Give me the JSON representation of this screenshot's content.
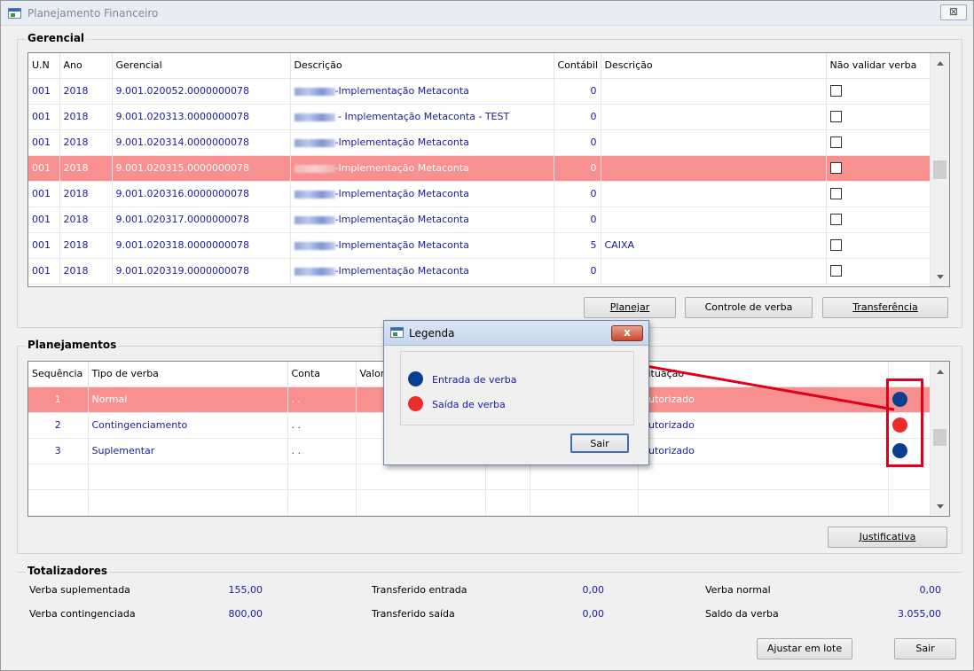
{
  "window": {
    "title": "Planejamento Financeiro",
    "close": "⊠"
  },
  "gerencial": {
    "label": "Gerencial",
    "columns": [
      "U.N",
      "Ano",
      "Gerencial",
      "Descrição",
      "Contábil",
      "Descrição",
      "Não validar verba"
    ],
    "rows": [
      {
        "un": "001",
        "ano": "2018",
        "gerencial": "9.001.020052.0000000078",
        "descricao": "-Implementação Metaconta",
        "contabil": "0",
        "descricao2": ""
      },
      {
        "un": "001",
        "ano": "2018",
        "gerencial": "9.001.020313.0000000078",
        "descricao": " - Implementação Metaconta - TEST",
        "contabil": "0",
        "descricao2": ""
      },
      {
        "un": "001",
        "ano": "2018",
        "gerencial": "9.001.020314.0000000078",
        "descricao": "-Implementação Metaconta",
        "contabil": "0",
        "descricao2": ""
      },
      {
        "un": "001",
        "ano": "2018",
        "gerencial": "9.001.020315.0000000078",
        "descricao": "-Implementação Metaconta",
        "contabil": "0",
        "descricao2": ""
      },
      {
        "un": "001",
        "ano": "2018",
        "gerencial": "9.001.020316.0000000078",
        "descricao": "-Implementação Metaconta",
        "contabil": "0",
        "descricao2": ""
      },
      {
        "un": "001",
        "ano": "2018",
        "gerencial": "9.001.020317.0000000078",
        "descricao": "-Implementação Metaconta",
        "contabil": "0",
        "descricao2": ""
      },
      {
        "un": "001",
        "ano": "2018",
        "gerencial": "9.001.020318.0000000078",
        "descricao": "-Implementação Metaconta",
        "contabil": "5",
        "descricao2": "CAIXA"
      },
      {
        "un": "001",
        "ano": "2018",
        "gerencial": "9.001.020319.0000000078",
        "descricao": "-Implementação Metaconta",
        "contabil": "0",
        "descricao2": ""
      }
    ],
    "buttons": {
      "planejar": "Planejar",
      "controle": "Controle de verba",
      "transferencia": "Transferência"
    }
  },
  "planejamentos": {
    "label": "Planejamentos",
    "columns": [
      "Sequência",
      "Tipo de verba",
      "Conta",
      "Valor",
      "",
      "",
      "Situação",
      ""
    ],
    "rows": [
      {
        "seq": "1",
        "tipo": "Normal",
        "conta": ". .",
        "situacao": "Autorizado",
        "dot": "#0b3d91"
      },
      {
        "seq": "2",
        "tipo": "Contingenciamento",
        "conta": ". .",
        "situacao": "Autorizado",
        "dot": "#ee2b2b"
      },
      {
        "seq": "3",
        "tipo": "Suplementar",
        "conta": ". .",
        "situacao": "Autorizado",
        "dot": "#0b3d91"
      }
    ],
    "justificativa": "Justificativa"
  },
  "totalizadores": {
    "label": "Totalizadores",
    "verba_suplementada_label": "Verba suplementada",
    "verba_suplementada": "155,00",
    "verba_contingenciada_label": "Verba contingenciada",
    "verba_contingenciada": "800,00",
    "transferido_entrada_label": "Transferido entrada",
    "transferido_entrada": "0,00",
    "transferido_saida_label": "Transferido saída",
    "transferido_saida": "0,00",
    "verba_normal_label": "Verba normal",
    "verba_normal": "0,00",
    "saldo_label": "Saldo da verba",
    "saldo": "3.055,00"
  },
  "footer": {
    "ajustar": "Ajustar em lote",
    "sair": "Sair"
  },
  "legenda": {
    "title": "Legenda",
    "close": "x",
    "entrada": "Entrada de verba",
    "saida": "Saída de verba",
    "sair": "Sair",
    "entrada_color": "#0b3d91",
    "saida_color": "#ee2b2b"
  },
  "colors": {
    "selection": "#f89090",
    "value_text": "#1a1aa0",
    "annotation": "#e0001a"
  }
}
